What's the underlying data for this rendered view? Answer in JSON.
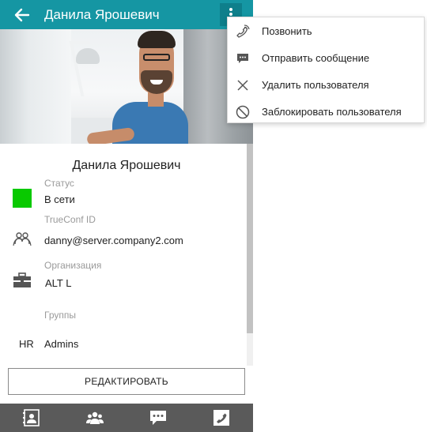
{
  "header": {
    "title": "Данила Ярошевич"
  },
  "profile": {
    "name": "Данила Ярошевич",
    "status_label": "Статус",
    "status_value": "В сети",
    "status_color": "#09c900",
    "trueconf_label": "TrueConf ID",
    "trueconf_value": "danny@server.company2.com",
    "org_label": "Организация",
    "org_value": "ALT L",
    "groups_label": "Группы",
    "group_prefix": "HR",
    "group_value": "Admins"
  },
  "edit_button": "РЕДАКТИРОВАТЬ",
  "bottom_tabs": [
    {
      "icon": "contact-card-icon"
    },
    {
      "icon": "group-icon"
    },
    {
      "icon": "chat-icon"
    },
    {
      "icon": "phone-icon"
    }
  ],
  "menu": {
    "items": [
      {
        "label": "Позвонить",
        "icon": "call-icon"
      },
      {
        "label": "Отправить сообщение",
        "icon": "message-icon"
      },
      {
        "label": "Удалить пользователя",
        "icon": "close-icon"
      },
      {
        "label": "Заблокировать пользователя",
        "icon": "block-icon"
      }
    ]
  },
  "colors": {
    "header": "#1596a3",
    "bottom_bar": "#5a5a5a",
    "status_online": "#09c900"
  }
}
